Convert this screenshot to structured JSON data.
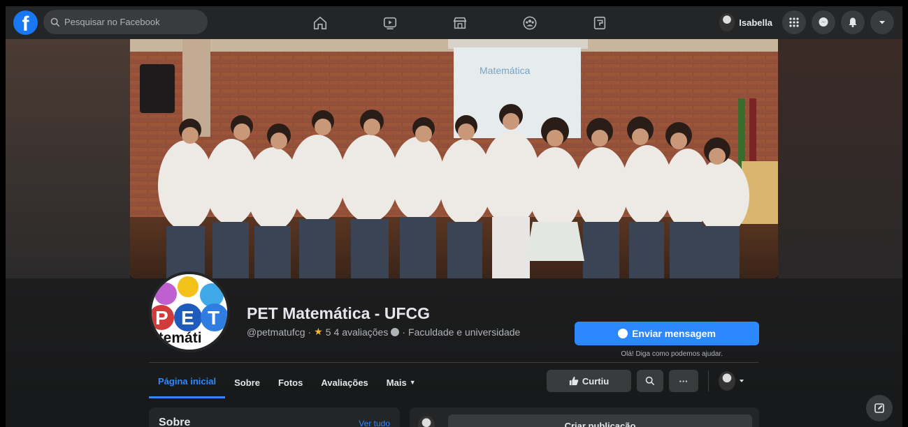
{
  "topbar": {
    "logo_letter": "f",
    "search_placeholder": "Pesquisar no Facebook",
    "nav_icons": [
      "home-icon",
      "watch-icon",
      "marketplace-icon",
      "groups-icon",
      "gaming-icon"
    ],
    "user_name": "Isabella",
    "right_icons": [
      "menu-grid-icon",
      "messenger-icon",
      "notifications-icon",
      "account-dropdown-icon"
    ]
  },
  "profile": {
    "logo_letters": [
      "P",
      "E",
      "T"
    ],
    "logo_word": "atemáti",
    "title": "PET Matemática - UFCG",
    "handle": "@petmatufcg",
    "sep1": " · ",
    "rating": "5",
    "reviews": "4 avaliações",
    "sep2": " · ",
    "category": "Faculdade e universidade",
    "send_message": "Enviar mensagem",
    "helper_text": "Olá! Diga como podemos ajudar."
  },
  "cover": {
    "screen_text": "Matemática"
  },
  "tabs": [
    {
      "label": "Página inicial"
    },
    {
      "label": "Sobre"
    },
    {
      "label": "Fotos"
    },
    {
      "label": "Avaliações"
    },
    {
      "label": "Mais"
    }
  ],
  "actions": {
    "like_label": "Curtiu",
    "more_label": "···"
  },
  "content": {
    "about_title": "Sobre",
    "about_link": "Ver tudo",
    "create_post": "Criar publicação"
  },
  "colors": {
    "accent": "#2d88ff",
    "surface": "#242526",
    "background": "#18191a",
    "star": "#f7b928"
  }
}
